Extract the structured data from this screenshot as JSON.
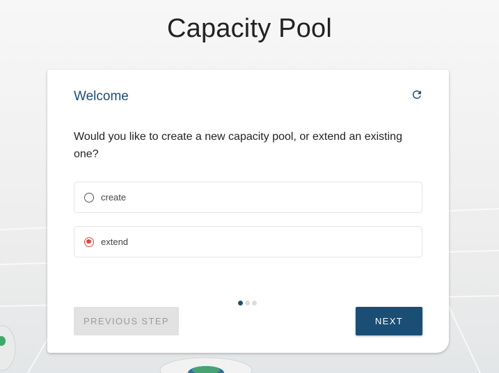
{
  "page": {
    "title": "Capacity Pool"
  },
  "card": {
    "heading": "Welcome",
    "refresh_icon": "refresh-icon",
    "question": "Would you like to create a new capacity pool, or extend an existing one?",
    "options": [
      {
        "label": "create",
        "selected": false
      },
      {
        "label": "extend",
        "selected": true
      }
    ],
    "steps": {
      "total": 3,
      "current": 1
    },
    "previous_label": "PREVIOUS STEP",
    "previous_enabled": false,
    "next_label": "NEXT"
  },
  "colors": {
    "accent": "#1a4e75",
    "radio_selected": "#e0483c",
    "disabled_button_bg": "#e2e2e2",
    "disabled_button_text": "#9b9b9b"
  }
}
